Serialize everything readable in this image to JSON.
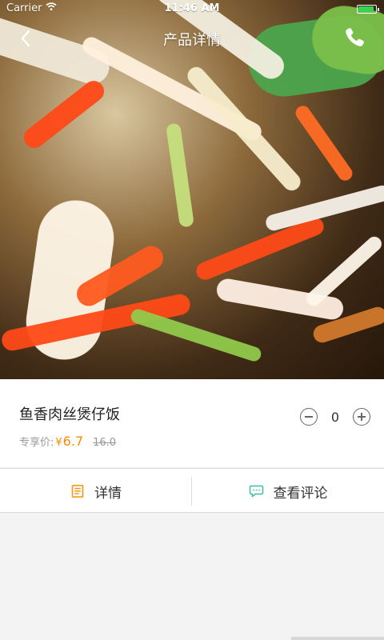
{
  "status_bar": {
    "carrier": "Carrier",
    "time": "11:46 AM",
    "battery_level": 0.9,
    "signal_icon": "wifi-icon",
    "battery_icon": "battery-icon"
  },
  "nav": {
    "title": "产品详情",
    "back_icon": "back-arrow-icon",
    "phone_icon": "phone-icon"
  },
  "product": {
    "name": "鱼香肉丝煲仔饭",
    "price_label": "专享价:",
    "currency": "¥",
    "price": "6.7",
    "old_price": "16.0",
    "quantity": "0"
  },
  "tabs": [
    {
      "label": "详情",
      "icon": "document-icon",
      "color": "#f59a22"
    },
    {
      "label": "查看评论",
      "icon": "comment-icon",
      "color": "#3dbba6"
    }
  ],
  "colors": {
    "accent": "#ff8a00",
    "review_icon": "#3dbba6",
    "detail_icon": "#f59a22"
  }
}
